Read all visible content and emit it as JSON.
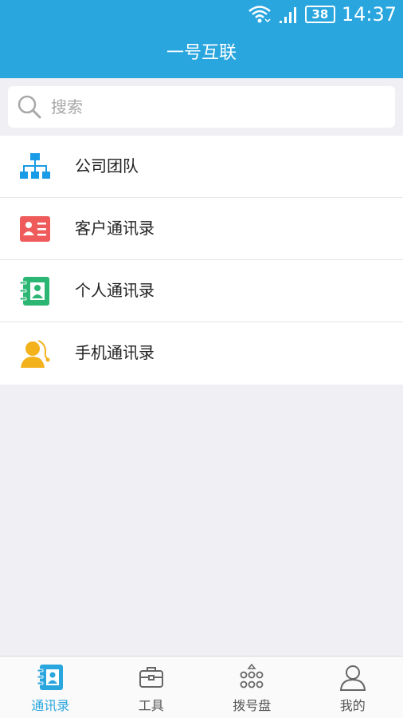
{
  "status_bar": {
    "battery": "38",
    "time": "14:37"
  },
  "header": {
    "title": "一号互联"
  },
  "search": {
    "placeholder": "搜索",
    "value": ""
  },
  "menu": {
    "items": [
      {
        "label": "公司团队",
        "icon": "org-chart-icon",
        "color": "#1a9be6"
      },
      {
        "label": "客户通讯录",
        "icon": "contact-card-icon",
        "color": "#ef5a5a"
      },
      {
        "label": "个人通讯录",
        "icon": "address-book-icon",
        "color": "#2bb673"
      },
      {
        "label": "手机通讯录",
        "icon": "phone-contacts-icon",
        "color": "#f3b21b"
      }
    ]
  },
  "tabs": [
    {
      "label": "通讯录",
      "icon": "contacts-book-icon",
      "active": true
    },
    {
      "label": "工具",
      "icon": "toolbox-icon",
      "active": false
    },
    {
      "label": "拨号盘",
      "icon": "dialpad-icon",
      "active": false
    },
    {
      "label": "我的",
      "icon": "user-profile-icon",
      "active": false
    }
  ],
  "colors": {
    "accent": "#2aa6df",
    "background": "#efeff4"
  }
}
